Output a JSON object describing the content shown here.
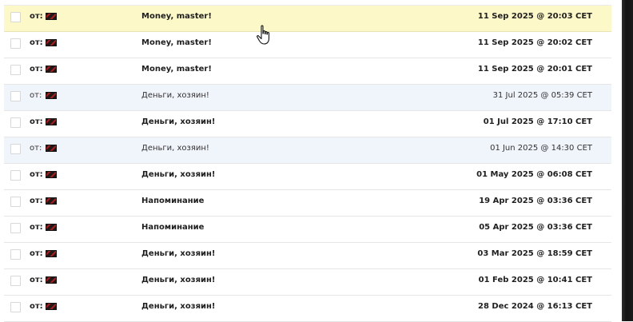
{
  "messages": [
    {
      "from_label": "от:",
      "subject": "Money, master!",
      "date": "11 Sep 2025 @ 20:03 CET",
      "state": "hover"
    },
    {
      "from_label": "от:",
      "subject": "Money, master!",
      "date": "11 Sep 2025 @ 20:02 CET",
      "state": "unread"
    },
    {
      "from_label": "от:",
      "subject": "Money, master!",
      "date": "11 Sep 2025 @ 20:01 CET",
      "state": "unread"
    },
    {
      "from_label": "от:",
      "subject": "Деньги, хозяин!",
      "date": "31 Jul 2025 @ 05:39 CET",
      "state": "read"
    },
    {
      "from_label": "от:",
      "subject": "Деньги, хозяин!",
      "date": "01 Jul 2025 @ 17:10 CET",
      "state": "unread"
    },
    {
      "from_label": "от:",
      "subject": "Деньги, хозяин!",
      "date": "01 Jun 2025 @ 14:30 CET",
      "state": "read"
    },
    {
      "from_label": "от:",
      "subject": "Деньги, хозяин!",
      "date": "01 May 2025 @ 06:08 CET",
      "state": "unread"
    },
    {
      "from_label": "от:",
      "subject": "Напоминание",
      "date": "19 Apr 2025 @ 03:36 CET",
      "state": "unread"
    },
    {
      "from_label": "от:",
      "subject": "Напоминание",
      "date": "05 Apr 2025 @ 03:36 CET",
      "state": "unread"
    },
    {
      "from_label": "от:",
      "subject": "Деньги, хозяин!",
      "date": "03 Mar 2025 @ 18:59 CET",
      "state": "unread"
    },
    {
      "from_label": "от:",
      "subject": "Деньги, хозяин!",
      "date": "01 Feb 2025 @ 10:41 CET",
      "state": "unread"
    },
    {
      "from_label": "от:",
      "subject": "Деньги, хозяин!",
      "date": "28 Dec 2024 @ 16:13 CET",
      "state": "unread"
    }
  ],
  "colors": {
    "hover_row": "#fdf8c7",
    "read_row": "#f0f4fb",
    "sender_flag": "#b21818"
  },
  "icons": {
    "sender": "flag-icon",
    "pointer": "hand-pointer-icon"
  }
}
